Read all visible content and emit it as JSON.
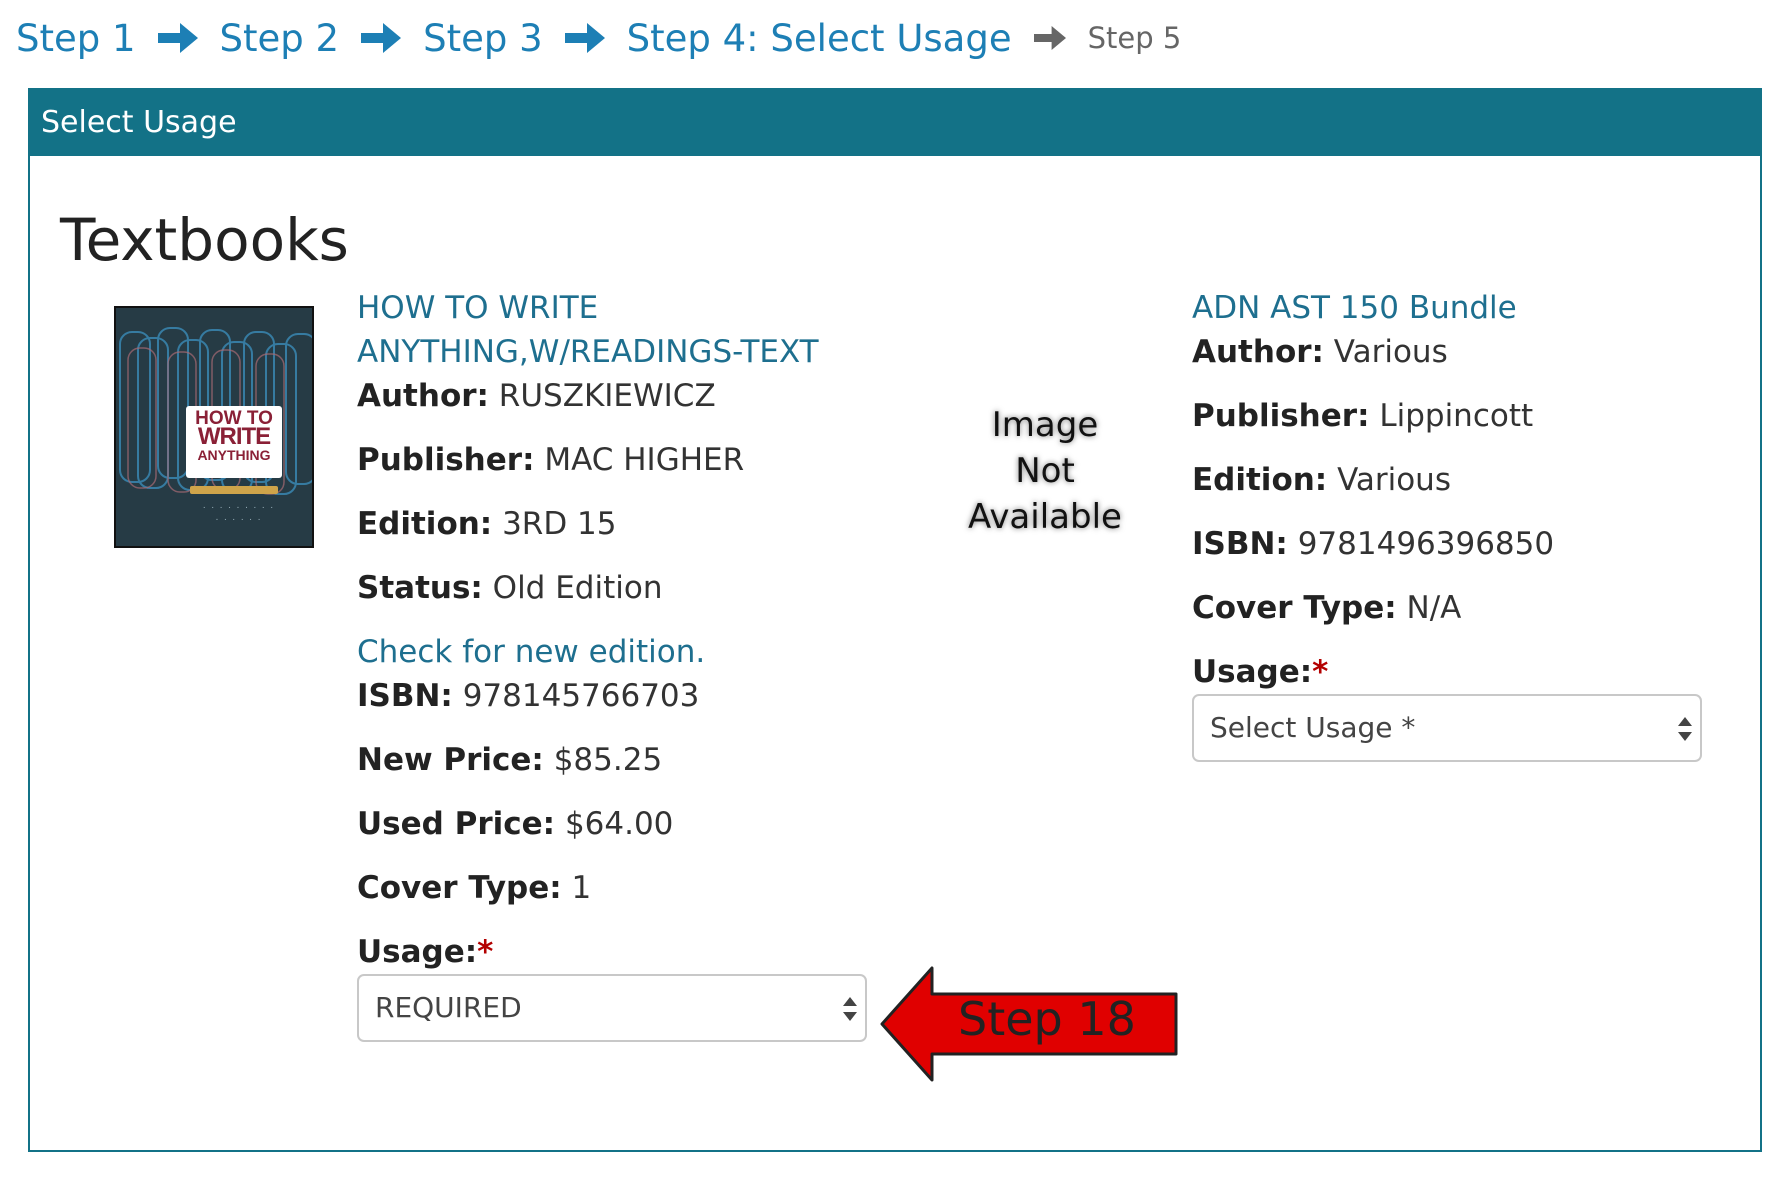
{
  "breadcrumb": {
    "steps": [
      "Step 1",
      "Step 2",
      "Step 3",
      "Step 4: Select Usage",
      "Step 5"
    ],
    "arrow_icon": "right-arrow-icon"
  },
  "panel": {
    "header": "Select Usage",
    "section_title": "Textbooks"
  },
  "books": [
    {
      "title_line1": "HOW TO WRITE",
      "title_line2": "ANYTHING,W/READINGS-TEXT",
      "cover": {
        "l1": "HOW TO",
        "l2": "WRITE",
        "l3": "ANYTHING"
      },
      "fields": {
        "author_label": "Author:",
        "author": "RUSZKIEWICZ",
        "publisher_label": "Publisher:",
        "publisher": "MAC HIGHER",
        "edition_label": "Edition:",
        "edition": "3RD 15",
        "status_label": "Status:",
        "status": "Old Edition",
        "check_link": "Check for new edition.",
        "isbn_label": "ISBN:",
        "isbn": "978145766703",
        "new_price_label": "New Price:",
        "new_price": "$85.25",
        "used_price_label": "Used Price:",
        "used_price": "$64.00",
        "cover_type_label": "Cover Type:",
        "cover_type": "1"
      },
      "usage_label": "Usage:",
      "usage_required_mark": "*",
      "usage_value": "REQUIRED"
    },
    {
      "title": "ADN AST 150 Bundle",
      "image_placeholder": [
        "Image",
        "Not",
        "Available"
      ],
      "fields": {
        "author_label": "Author:",
        "author": "Various",
        "publisher_label": "Publisher:",
        "publisher": "Lippincott",
        "edition_label": "Edition:",
        "edition": "Various",
        "isbn_label": "ISBN:",
        "isbn": "9781496396850",
        "cover_type_label": "Cover Type:",
        "cover_type": "N/A"
      },
      "usage_label": "Usage:",
      "usage_required_mark": "*",
      "usage_value": "Select Usage *"
    }
  ],
  "callout": {
    "text": "Step 18",
    "color": "#e00000"
  },
  "colors": {
    "link": "#1d7fb5",
    "panel_header": "#137287",
    "required": "#b30000"
  }
}
